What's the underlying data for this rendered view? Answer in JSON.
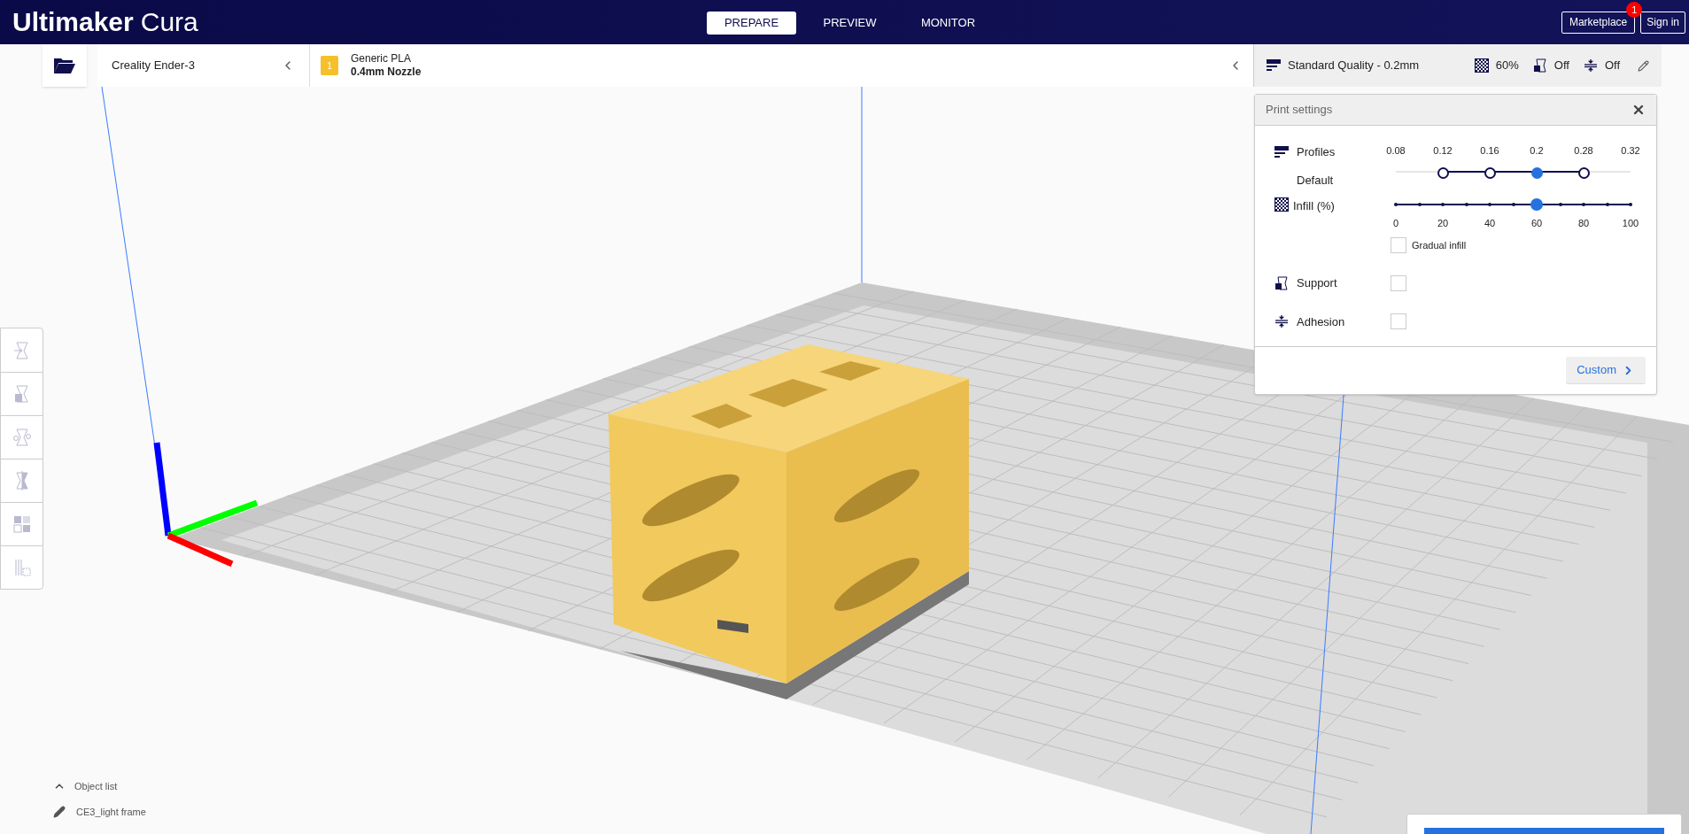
{
  "header": {
    "logo_bold": "Ultimaker",
    "logo_light": "Cura",
    "marketplace": "Marketplace",
    "marketplace_badge": "1",
    "sign_in": "Sign in",
    "stages": [
      {
        "label": "PREPARE",
        "selected": true
      },
      {
        "label": "PREVIEW",
        "selected": false
      },
      {
        "label": "MONITOR",
        "selected": false
      }
    ]
  },
  "printer": {
    "name": "Creality Ender-3"
  },
  "material": {
    "extruder": "1",
    "name": "Generic PLA",
    "nozzle": "0.4mm Nozzle"
  },
  "quality_bar": {
    "profile": "Standard Quality - 0.2mm",
    "infill": "60%",
    "support": "Off",
    "adhesion": "Off"
  },
  "print_settings": {
    "title": "Print settings",
    "profiles": {
      "label": "Profiles",
      "sublabel": "Default",
      "options": [
        {
          "label": "0.08",
          "available": false,
          "selected": false
        },
        {
          "label": "0.12",
          "available": true,
          "selected": false
        },
        {
          "label": "0.16",
          "available": true,
          "selected": false
        },
        {
          "label": "0.2",
          "available": true,
          "selected": true
        },
        {
          "label": "0.28",
          "available": true,
          "selected": false
        },
        {
          "label": "0.32",
          "available": false,
          "selected": false
        }
      ]
    },
    "infill": {
      "label": "Infill (%)",
      "level": 0.6,
      "ticks": [
        "0",
        "20",
        "40",
        "60",
        "80",
        "100"
      ]
    },
    "gradual_infill": {
      "label": "Gradual infill",
      "checked": false
    },
    "support": {
      "label": "Support",
      "checked": false
    },
    "adhesion": {
      "label": "Adhesion",
      "checked": false
    },
    "custom_button": "Custom"
  },
  "object_list": {
    "label": "Object list",
    "object_name": "CE3_light frame"
  }
}
